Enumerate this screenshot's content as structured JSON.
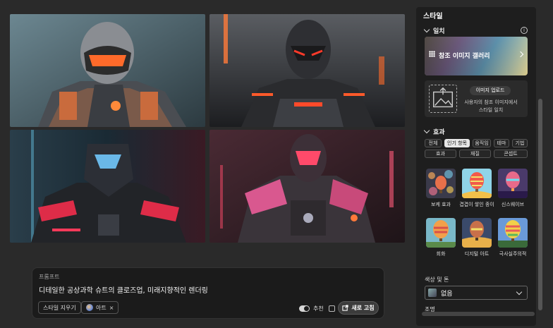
{
  "panel": {
    "title": "스타일",
    "match_section": "일치",
    "gallery_label": "참조 이미지 갤러리",
    "upload_button": "이미지 업로드",
    "upload_desc_line1": "사용자의 참조 이미지에서",
    "upload_desc_line2": "스타일 일치",
    "effects_section": "효과",
    "tags_row1": [
      "전체",
      "인기 항목",
      "움직임",
      "테마",
      "기법"
    ],
    "tags_row2": [
      "효과",
      "재질",
      "콘셉트"
    ],
    "active_tag": "인기 항목",
    "thumbs": [
      {
        "label": "보케 효과"
      },
      {
        "label": "겹겹이 쌓인 종이"
      },
      {
        "label": "신스웨이브"
      },
      {
        "label": "회화"
      },
      {
        "label": "디지털 아트"
      },
      {
        "label": "극사실주의적"
      }
    ],
    "color_tone_label": "색상 및 톤",
    "color_tone_value": "없음",
    "lighting_label": "조명"
  },
  "prompt": {
    "label": "프롬프트",
    "text": "디테일한 공상과학 슈트의 클로즈업, 미래지향적인 렌더링",
    "clear_style": "스타일 지우기",
    "art_chip": "아트",
    "art_chip_close": "×",
    "recommend_label": "추천",
    "refresh_button": "새로 고침"
  },
  "colors": {
    "accent_orange": "#ff6a2a",
    "accent_red": "#ff2e4d",
    "accent_pink": "#d9588f"
  }
}
